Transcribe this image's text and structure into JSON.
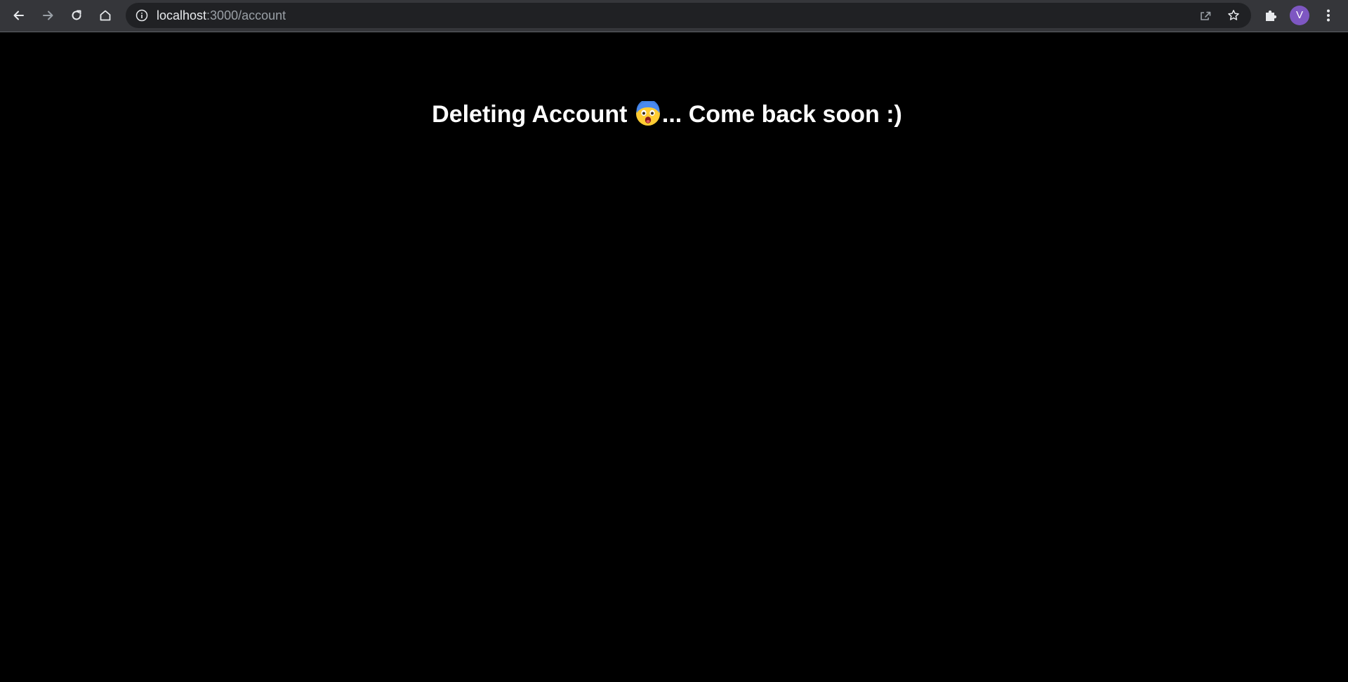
{
  "browser": {
    "url_host": "localhost",
    "url_path": ":3000/account",
    "profile_initial": "V",
    "profile_color": "#7e57c2",
    "toolbar_color": "#35363a",
    "omnibox_color": "#202124"
  },
  "toolbar_icons": {
    "back": "back-arrow-icon",
    "forward": "forward-arrow-icon",
    "reload": "reload-icon",
    "home": "home-icon",
    "site_info": "info-icon",
    "share": "share-icon",
    "bookmark": "star-icon",
    "extensions": "puzzle-icon",
    "menu": "kebab-menu-icon"
  },
  "page": {
    "heading_before": "Deleting Account",
    "heading_emoji": "fearful-face-icon",
    "heading_after": "... Come back soon :)",
    "background": "#000000",
    "text_color": "#ffffff"
  }
}
